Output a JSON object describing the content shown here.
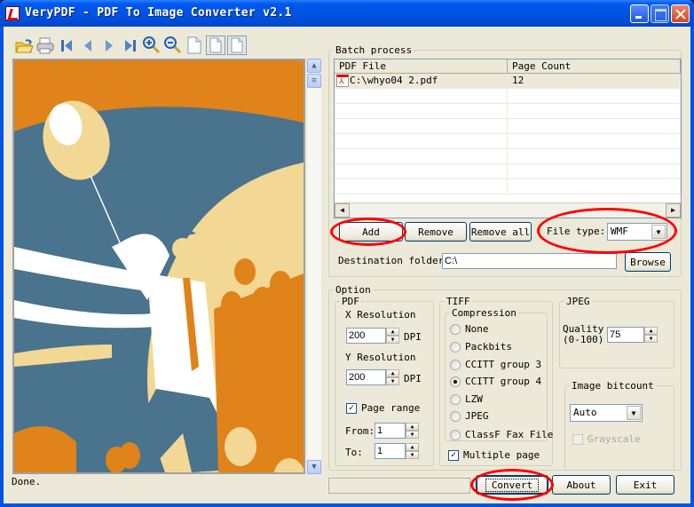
{
  "window": {
    "title": "VeryPDF - PDF To Image Converter v2.1",
    "controls": [
      "minimize",
      "maximize",
      "close"
    ]
  },
  "toolbar": {
    "tools": [
      {
        "name": "open-icon",
        "glyph": "open"
      },
      {
        "name": "print-icon",
        "glyph": "print"
      },
      {
        "name": "first-page-icon",
        "glyph": "first"
      },
      {
        "name": "previous-page-icon",
        "glyph": "prev"
      },
      {
        "name": "next-page-icon",
        "glyph": "next"
      },
      {
        "name": "last-page-icon",
        "glyph": "last"
      },
      {
        "name": "zoom-in-icon",
        "glyph": "zoom-in"
      },
      {
        "name": "zoom-out-icon",
        "glyph": "zoom-out"
      },
      {
        "name": "page-icon",
        "glyph": "page"
      },
      {
        "name": "fit-page-icon",
        "glyph": "page"
      },
      {
        "name": "fit-width-icon",
        "glyph": "page"
      }
    ]
  },
  "viewer": {
    "colors": {
      "orange": "#df831a",
      "blue": "#4a738d",
      "cream": "#f2d894",
      "white": "#ffffff"
    }
  },
  "status": {
    "text": "Done."
  },
  "batch": {
    "legend": "Batch process",
    "columns": [
      "PDF File",
      "Page Count"
    ],
    "rows": [
      {
        "file": "C:\\whyo04 2.pdf",
        "pages": "12"
      }
    ],
    "add_label": "Add",
    "remove_label": "Remove",
    "remove_all_label": "Remove all",
    "file_type_label": "File type:",
    "file_type_value": "WMF",
    "dest_label": "Destination folder",
    "dest_value": "C:\\",
    "browse_label": "Browse"
  },
  "option": {
    "legend": "Option",
    "pdf": {
      "legend": "PDF",
      "x_res_label": "X Resolution",
      "x_res_value": "200",
      "y_res_label": "Y Resolution",
      "y_res_value": "200",
      "dpi_label": "DPI",
      "page_range_label": "Page range",
      "page_range_checked": true,
      "from_label": "From:",
      "from_value": "1",
      "to_label": "To:",
      "to_value": "1"
    },
    "tiff": {
      "legend": "TIFF",
      "compression_legend": "Compression",
      "options": [
        "None",
        "Packbits",
        "CCITT group 3",
        "CCITT group 4",
        "LZW",
        "JPEG",
        "ClassF Fax File"
      ],
      "selected": "CCITT group 4",
      "multiple_page_label": "Multiple page",
      "multiple_page_checked": true
    },
    "jpeg": {
      "legend": "JPEG",
      "quality_label": "Quality",
      "quality_range": "(0-100)",
      "quality_value": "75"
    },
    "bitcount": {
      "legend": "Image bitcount",
      "value": "Auto",
      "grayscale_label": "Grayscale",
      "grayscale_checked": false
    }
  },
  "footer": {
    "progress": 0,
    "convert_label": "Convert",
    "about_label": "About",
    "exit_label": "Exit"
  },
  "annotations": {
    "highlight_color": "#ff0000",
    "highlighted": [
      "Add",
      "File type",
      "Convert"
    ]
  }
}
